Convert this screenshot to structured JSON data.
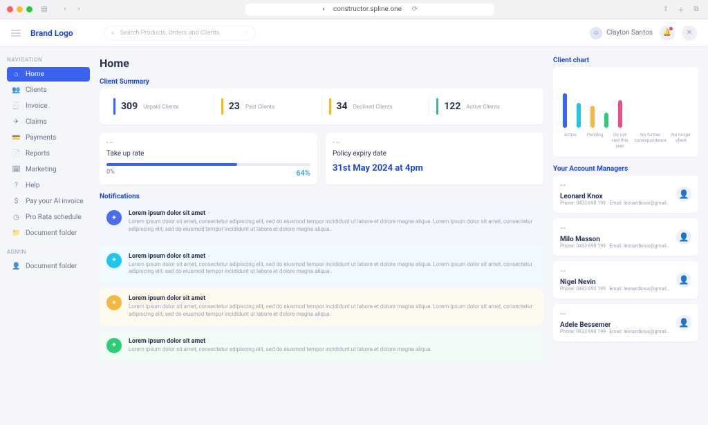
{
  "browser": {
    "url": "constructor.spline.one"
  },
  "brand": "Brand Logo",
  "search": {
    "placeholder": "Search Products, Orders and Clients"
  },
  "user": {
    "name": "Clayton Santos"
  },
  "sidebar": {
    "nav_label": "NAVIGATION",
    "admin_label": "ADMIN",
    "items": [
      {
        "label": "Home",
        "icon": "home-icon",
        "active": true
      },
      {
        "label": "Clients",
        "icon": "users-icon"
      },
      {
        "label": "Invoice",
        "icon": "invoice-icon"
      },
      {
        "label": "Claims",
        "icon": "send-icon"
      },
      {
        "label": "Payments",
        "icon": "card-icon"
      },
      {
        "label": "Reports",
        "icon": "file-icon"
      },
      {
        "label": "Marketing",
        "icon": "calendar-icon"
      },
      {
        "label": "Help",
        "icon": "help-icon"
      },
      {
        "label": "Pay your AI invoice",
        "icon": "dollar-icon"
      },
      {
        "label": "Pro Rata schedule",
        "icon": "clock-icon"
      },
      {
        "label": "Document folder",
        "icon": "folder-icon"
      }
    ],
    "admin_items": [
      {
        "label": "Document folder",
        "icon": "user-icon"
      }
    ]
  },
  "page": {
    "title": "Home"
  },
  "client_summary": {
    "title": "Client Summary",
    "cells": [
      {
        "value": "309",
        "label": "Unpaid Clients",
        "accent": "bar-blue"
      },
      {
        "value": "23",
        "label": "Paid Clients",
        "accent": "bar-amber"
      },
      {
        "value": "34",
        "label": "Declined Clients",
        "accent": "bar-amber"
      },
      {
        "value": "122",
        "label": "Active Clients",
        "accent": "bar-green"
      }
    ]
  },
  "take_up": {
    "pre": "• ••",
    "title": "Take up rate",
    "lo": "0%",
    "pct": "64%",
    "fill_pct": 64
  },
  "expiry": {
    "pre": "• ••",
    "title": "Policy expiry date",
    "value": "31st May 2024 at 4pm"
  },
  "notifications": {
    "title": "Notifications",
    "items": [
      {
        "bg": "bg-lav",
        "icon": "ic-blue",
        "title": "Lorem ipsum dolor sit amet",
        "text": "Lorem ipsum dolor sit amet, consectetur adipiscing elit, sed do eiusmod tempor incididunt ut labore et dolore magna aliqua. Lorem ipsum dolor sit amet, consectetur adipiscing elit, sed do eiusmod tempor incididunt ut labore et dolore magna aliqua."
      },
      {
        "bg": "bg-sky",
        "icon": "ic-cyan",
        "title": "Lorem ipsum dolor sit amet",
        "text": "Lorem ipsum dolor sit amet, consectetur adipiscing elit, sed do eiusmod tempor incididunt ut labore et dolore magna aliqua. Lorem ipsum dolor sit amet, consectetur adipiscing elit, sed do eiusmod tempor incididunt ut labore et dolore magna aliqua."
      },
      {
        "bg": "bg-sun",
        "icon": "ic-amber",
        "title": "Lorem ipsum dolor sit amet",
        "text": "Lorem ipsum dolor sit amet, consectetur adipiscing elit, sed do eiusmod tempor incididunt ut labore et dolore magna aliqua. Lorem ipsum dolor sit amet, consectetur adipiscing elit, sed do eiusmod tempor incididunt ut labore et dolore magna aliqua."
      },
      {
        "bg": "bg-mint",
        "icon": "ic-green",
        "title": "Lorem ipsum dolor sit amet",
        "text": "Lorem ipsum dolor sit amet, consectetur adipiscing elit, sed do eiusmod tempor incididunt ut labore et dolore magna aliqua."
      }
    ]
  },
  "client_chart": {
    "title": "Client chart"
  },
  "chart_data": {
    "type": "bar",
    "categories": [
      "Active",
      "Pending",
      "Do not visit this year",
      "No further correspondence",
      "No longer client"
    ],
    "values": [
      70,
      50,
      45,
      30,
      55
    ],
    "colors": [
      "#3a63f0",
      "#1fc6ea",
      "#f4b840",
      "#2bcf73",
      "#e84f8a"
    ],
    "ylim": [
      0,
      100
    ]
  },
  "managers": {
    "title": "Your Account Managers",
    "items": [
      {
        "name": "Leonard Knox",
        "phone": "Phone: 0433 690 199",
        "email": "Email: leonardknox@gmail.com"
      },
      {
        "name": "Milo Masson",
        "phone": "Phone: 0433 690 199",
        "email": "Email: leonardknox@gmail.com"
      },
      {
        "name": "Nigel Nevin",
        "phone": "Phone: 0433 690 199",
        "email": "Email: leonardknox@gmail.com"
      },
      {
        "name": "Adele Bessemer",
        "phone": "Phone: 0433 690 199",
        "email": "Email: leonardknox@gmail.com"
      }
    ]
  }
}
